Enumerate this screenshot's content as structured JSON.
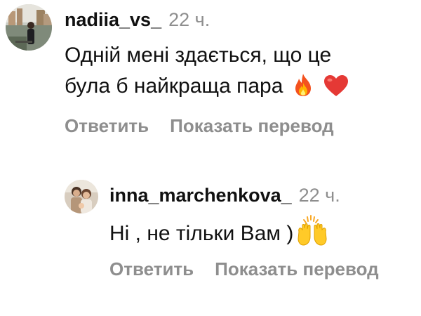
{
  "comments": [
    {
      "username": "nadiia_vs_",
      "time": "22 ч.",
      "text_lines": [
        "Одній мені здається, що це",
        "була б найкраща пара"
      ],
      "emojis": [
        "fire-emoji",
        "red-heart-emoji"
      ],
      "actions": {
        "reply": "Ответить",
        "translate": "Показать перевод"
      }
    },
    {
      "username": "inna_marchenkova_",
      "time": "22 ч.",
      "text": "Ні , не тільки Вам )",
      "emojis": [
        "raising-hands-emoji"
      ],
      "actions": {
        "reply": "Ответить",
        "translate": "Показать перевод"
      }
    }
  ],
  "colors": {
    "text": "#111111",
    "muted": "#8e8e8e",
    "background": "#ffffff"
  }
}
